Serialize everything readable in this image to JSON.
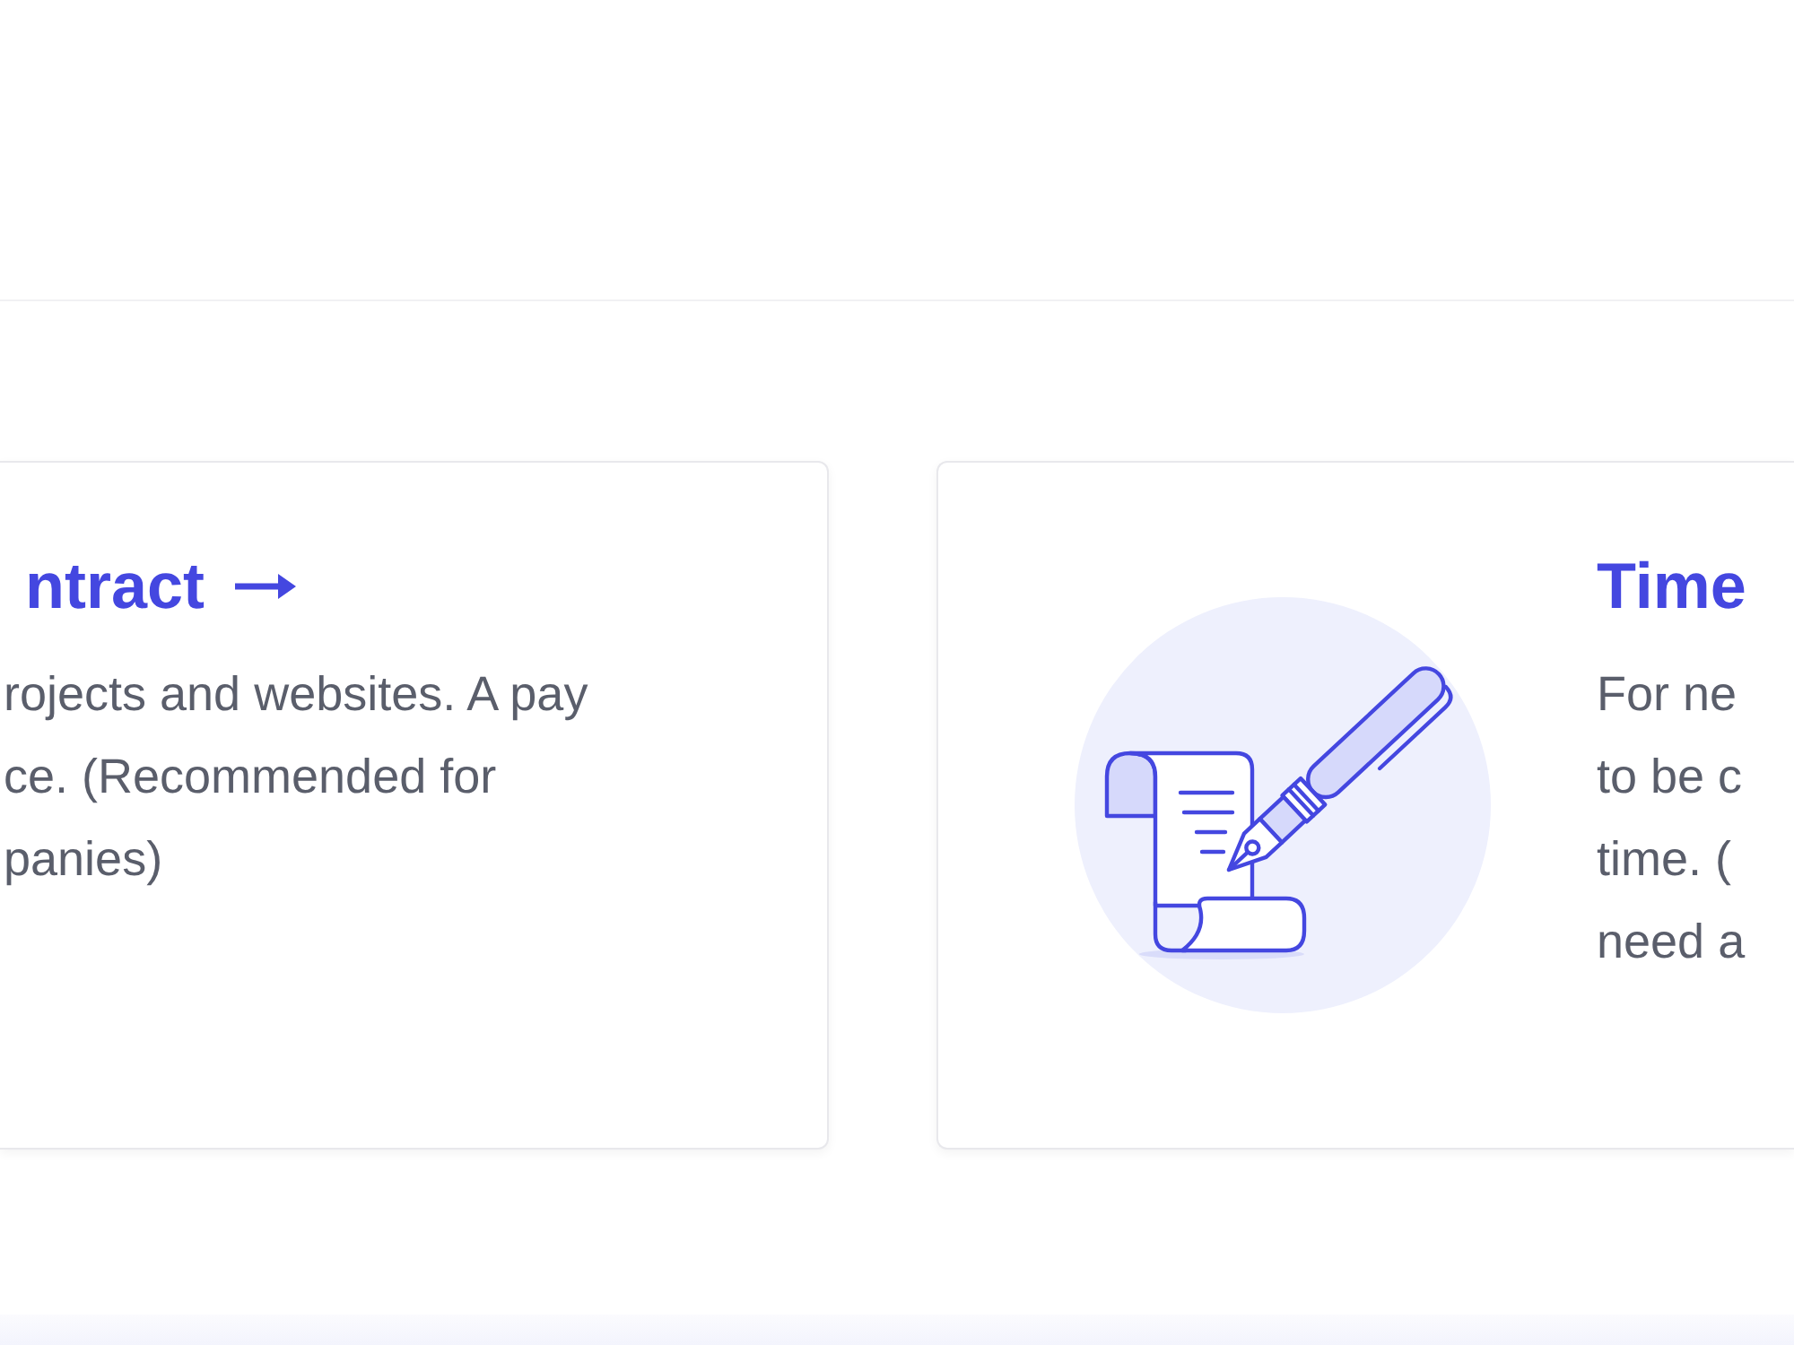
{
  "cards": [
    {
      "kind": "text",
      "title": "ntract",
      "title_arrow": true,
      "description_lines": [
        "rojects and websites. A pay",
        "ce. (Recommended for",
        "panies)"
      ]
    },
    {
      "kind": "illustrated",
      "title": "Time",
      "description_lines": [
        "For ne",
        "to be c",
        "time. (",
        "need a"
      ]
    }
  ]
}
